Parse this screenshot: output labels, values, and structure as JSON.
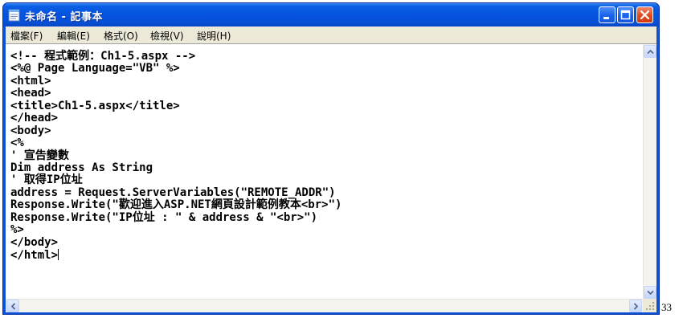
{
  "window": {
    "title": "未命名 - 記事本",
    "app_icon": "notepad-icon",
    "controls": {
      "minimize_icon": "minimize-icon",
      "maximize_icon": "maximize-icon",
      "close_icon": "close-icon"
    }
  },
  "menu": [
    {
      "label": "檔案(F)"
    },
    {
      "label": "編輯(E)"
    },
    {
      "label": "格式(O)"
    },
    {
      "label": "檢視(V)"
    },
    {
      "label": "說明(H)"
    }
  ],
  "editor": {
    "lines": [
      "<!-- 程式範例：Ch1-5.aspx -->",
      "<%@ Page Language=\"VB\" %>",
      "<html>",
      "<head>",
      "<title>Ch1-5.aspx</title>",
      "</head>",
      "<body>",
      "<%",
      "' 宣告變數",
      "Dim address As String",
      "' 取得IP位址",
      "address = Request.ServerVariables(\"REMOTE_ADDR\")",
      "Response.Write(\"歡迎進入ASP.NET網頁設計範例教本<br>\")",
      "Response.Write(\"IP位址 : \" & address & \"<br>\")",
      "%>",
      "</body>",
      "</html>"
    ]
  },
  "page_number": "33",
  "colors": {
    "titlebar": "#0554e0",
    "menubar": "#ece9d8",
    "close_button": "#e0491f"
  }
}
